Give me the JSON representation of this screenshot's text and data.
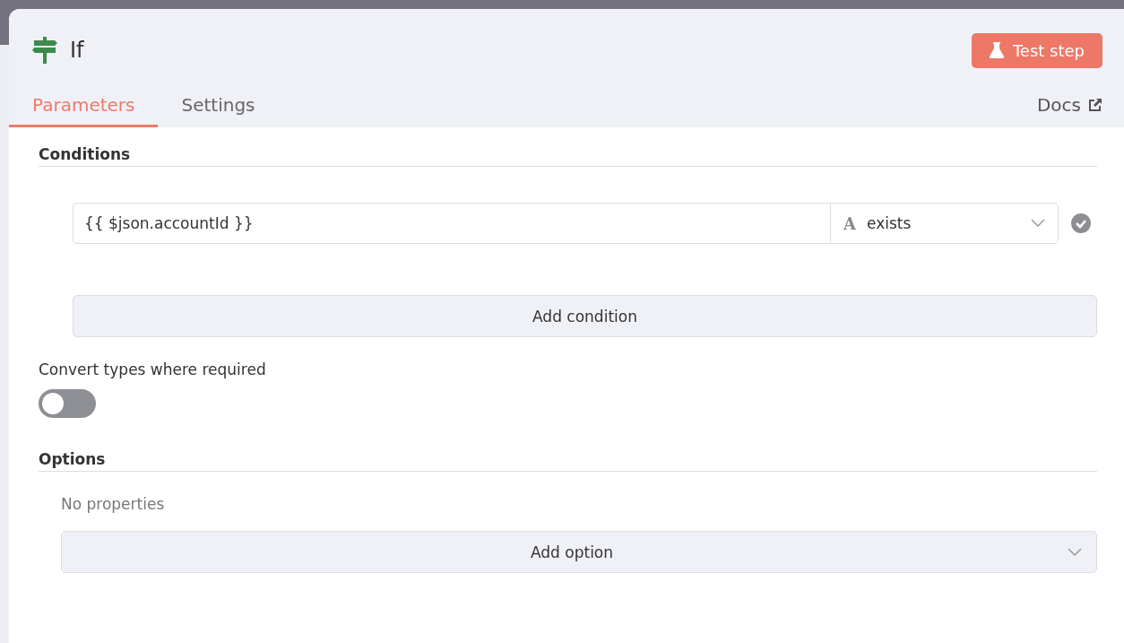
{
  "node": {
    "title": "If"
  },
  "test_button": {
    "label": "Test step"
  },
  "tabs": [
    {
      "label": "Parameters",
      "selected": true
    },
    {
      "label": "Settings",
      "selected": false
    }
  ],
  "docs_link": {
    "label": "Docs"
  },
  "conditions": {
    "heading": "Conditions",
    "rows": [
      {
        "value": "{{ $json.accountId }}",
        "operator": "exists",
        "type_glyph": "A"
      }
    ],
    "add_button": "Add condition"
  },
  "convert_types": {
    "label": "Convert types where required",
    "on": false
  },
  "options": {
    "heading": "Options",
    "empty_text": "No properties",
    "add_button": "Add option"
  }
}
